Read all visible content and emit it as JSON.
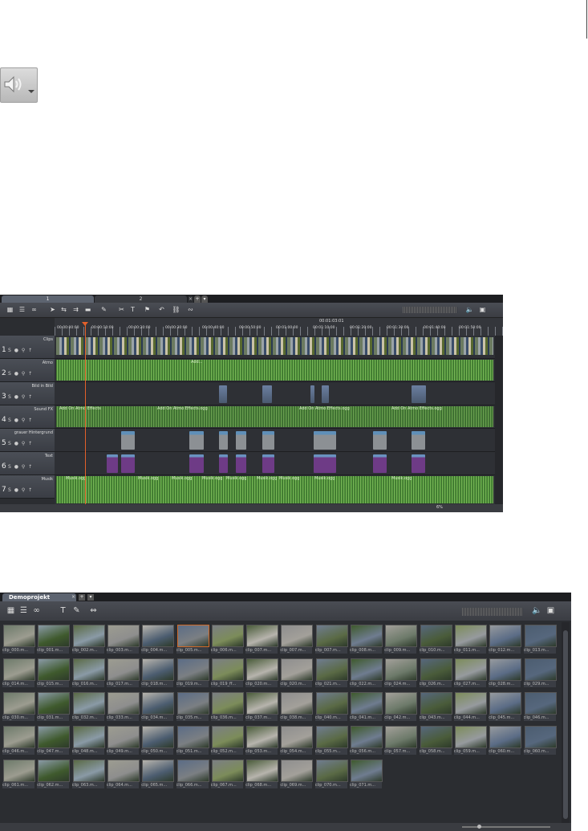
{
  "timeline": {
    "tabs": [
      "1",
      "2"
    ],
    "timecode": "00:01:03:01",
    "ticks": [
      "00:00:00:00",
      "00:00:10:00",
      "00:00:20:00",
      "00:00:30:00",
      "00:00:40:00",
      "00:00:50:00",
      "00:01:00:00",
      "00:01:10:00",
      "00:01:20:00",
      "00:01:30:00",
      "00:01:40:00",
      "00:01:50:00"
    ],
    "tracks": [
      {
        "num": "1",
        "name": "Clips"
      },
      {
        "num": "2",
        "name": "Atmo"
      },
      {
        "num": "3",
        "name": "Bild in Bild"
      },
      {
        "num": "4",
        "name": "Sound FX"
      },
      {
        "num": "5",
        "name": "grauer Hintergrund"
      },
      {
        "num": "6",
        "name": "Text"
      },
      {
        "num": "7",
        "name": "Musik"
      }
    ],
    "audio_labels": {
      "atmo": "Add...",
      "sfx": [
        "Add On Atmo Effects",
        "Add On Atmo Effects.ogg",
        "Add On Atmo Effects.ogg",
        "Add On Atmo Effects.ogg"
      ],
      "musik": [
        "Musik.ogg",
        "Musik.ogg",
        "Musik.ogg",
        "Musik.ogg",
        "Musik.ogg",
        "Musik.ogg",
        "Musik.ogg",
        "Musik.ogg",
        "Musik.ogg"
      ]
    },
    "zoom": "6%"
  },
  "mediapool": {
    "tab": "Demoprojekt",
    "clips": [
      "clip_000.m...",
      "clip_001.m...",
      "clip_002.m...",
      "clip_003.m...",
      "clip_004.m...",
      "clip_005.m...",
      "clip_006.m...",
      "clip_007.m...",
      "clip_007.m...",
      "clip_007.m...",
      "clip_008.m...",
      "clip_009.m...",
      "clip_010.m...",
      "clip_011.m...",
      "clip_012.m...",
      "clip_013.m...",
      "clip_014.m...",
      "clip_015.m...",
      "clip_016.m...",
      "clip_017.m...",
      "clip_018.m...",
      "clip_019.m...",
      "clip_019_ff...",
      "clip_020.m...",
      "clip_020.m...",
      "clip_021.m...",
      "clip_022.m...",
      "clip_024.m...",
      "clip_026.m...",
      "clip_027.m...",
      "clip_028.m...",
      "clip_029.m...",
      "clip_030.m...",
      "clip_031.m...",
      "clip_032.m...",
      "clip_033.m...",
      "clip_034.m...",
      "clip_035.m...",
      "clip_036.m...",
      "clip_037.m...",
      "clip_038.m...",
      "clip_040.m...",
      "clip_041.m...",
      "clip_042.m...",
      "clip_043.m...",
      "clip_044.m...",
      "clip_045.m...",
      "clip_046.m...",
      "clip_046.m...",
      "clip_047.m...",
      "clip_048.m...",
      "clip_049.m...",
      "clip_050.m...",
      "clip_051.m...",
      "clip_052.m...",
      "clip_053.m...",
      "clip_054.m...",
      "clip_055.m...",
      "clip_056.m...",
      "clip_057.m...",
      "clip_058.m...",
      "clip_059.m...",
      "clip_060.m...",
      "clip_060.m...",
      "clip_061.m...",
      "clip_062.m...",
      "clip_063.m...",
      "clip_064.m...",
      "clip_065.m...",
      "clip_066.m...",
      "clip_067.m...",
      "clip_068.m...",
      "clip_069.m...",
      "clip_070.m...",
      "clip_071.m..."
    ]
  },
  "colors": {
    "thumbs": [
      "#6d7a6a",
      "#8a9aa6",
      "#5a6a45",
      "#9c9c90",
      "#b7b4ad",
      "#5b6c86",
      "#7b7f83",
      "#4a5c3a",
      "#8e8e8e",
      "#6f7c90",
      "#3f5a2d",
      "#a3a09a",
      "#56677d",
      "#7c8c5a",
      "#969a9e",
      "#4c5d70"
    ]
  }
}
